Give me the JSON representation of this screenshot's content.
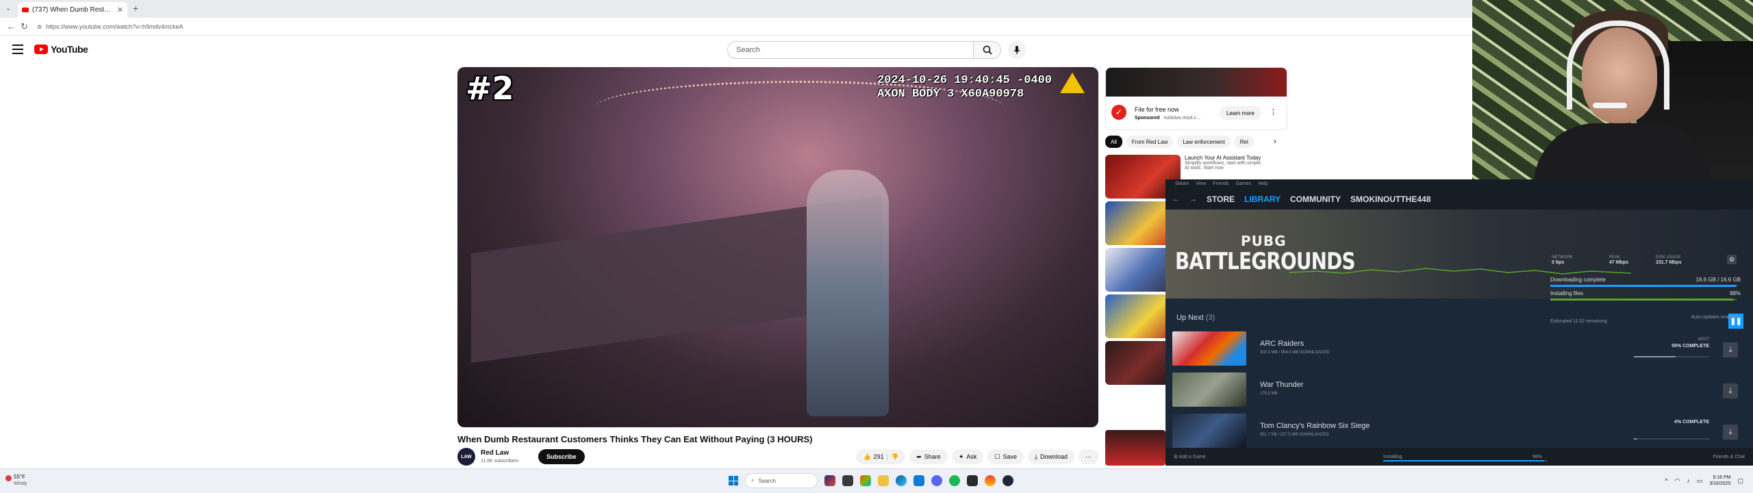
{
  "browser": {
    "tab_title": "(737) When Dumb Restaurant",
    "url": "https://www.youtube.com/watch?v=h9mdv4mckeA"
  },
  "youtube": {
    "logo_text": "YouTube",
    "search_placeholder": "Search",
    "video": {
      "rank_badge": "#2",
      "bodycam_line1": "2024-10-26 19:40:45 -0400",
      "bodycam_line2": "AXON BODY 3 X60A90978",
      "title": "When Dumb Restaurant Customers Thinks They Can Eat Without Paying (3 HOURS)"
    },
    "channel": {
      "avatar_text": "LAW",
      "name": "Red Law",
      "subs": "11.6K subscribers",
      "subscribe_label": "Subscribe"
    },
    "actions": {
      "likes": "291",
      "share": "Share",
      "ask": "Ask",
      "save": "Save",
      "download": "Download"
    },
    "ad": {
      "title": "File for free now",
      "sponsored": "Sponsored",
      "advertiser": "turbotax.intuit.c...",
      "learn_more": "Learn more"
    },
    "chips": [
      "All",
      "From Red Law",
      "Law enforcement",
      "Rel"
    ],
    "rec_ad": {
      "title": "Launch Your AI Assistant Today",
      "sub1": "Simplify workflows, start with simple",
      "sub2": "AI tools. Start now"
    }
  },
  "steam": {
    "menu": [
      "Steam",
      "View",
      "Friends",
      "Games",
      "Help"
    ],
    "nav": {
      "store": "STORE",
      "library": "LIBRARY",
      "community": "COMMUNITY",
      "user": "SMOKINOUTTHE448"
    },
    "hero": {
      "game_line1": "PUBG",
      "game_line2": "BATTLEGROUNDS",
      "network_label": "NETWORK",
      "network_value": "0 bps",
      "peak_label": "PEAK",
      "peak_value": "47 Mbps",
      "disk_label": "DISK USAGE",
      "disk_value": "331.7 Mbps",
      "downloading_label": "Downloading complete",
      "downloaded": "16.6 GB / 16.6 GB",
      "download_fraction": 1.0,
      "installing_label": "Installing files",
      "installing_pct": "98%",
      "install_fraction": 0.98,
      "eta": "Estimated 11:02 remaining"
    },
    "up_next_title": "Up Next",
    "up_next_count": "(3)",
    "auto_updates": "Auto-updates enabled",
    "queue": [
      {
        "name": "ARC Raiders",
        "size": "300.0 MB / 904.6 MB DOWNLOADED",
        "status": "55% COMPLETE",
        "status_top": "NEXT",
        "progress": 0.55
      },
      {
        "name": "War Thunder",
        "size": "179.5 MB",
        "status": "",
        "status_top": "",
        "progress": 0
      },
      {
        "name": "Tom Clancy's Rainbow Six Siege",
        "size": "951.7 KB / 237.5 MB DOWNLOADED",
        "status": "4% COMPLETE",
        "status_top": "",
        "progress": 0.04
      }
    ],
    "footer": {
      "add_game": "Add a Game",
      "installing": "Installing",
      "pct": "98%",
      "friends": "Friends & Chat"
    }
  },
  "taskbar": {
    "temp": "55°F",
    "weather": "Windy",
    "search": "Search",
    "time": "9:16 PM",
    "date": "3/16/2025"
  }
}
